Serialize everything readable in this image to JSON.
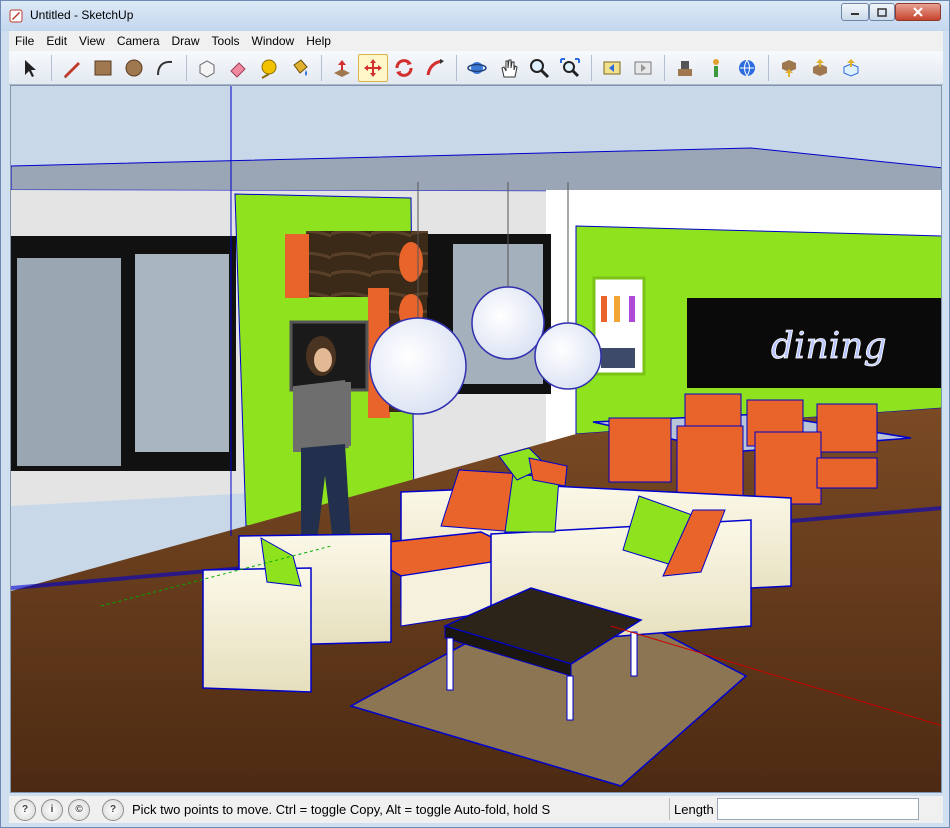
{
  "window": {
    "title": "Untitled - SketchUp"
  },
  "menu": [
    "File",
    "Edit",
    "View",
    "Camera",
    "Draw",
    "Tools",
    "Window",
    "Help"
  ],
  "toolbar": {
    "tools": [
      {
        "name": "select-tool-icon",
        "active": false
      },
      {
        "name": "pencil-line-tool-icon",
        "active": false
      },
      {
        "name": "rectangle-tool-icon",
        "active": false
      },
      {
        "name": "circle-tool-icon",
        "active": false
      },
      {
        "name": "arc-tool-icon",
        "active": false
      },
      {
        "name": "make-component-icon",
        "active": false
      },
      {
        "name": "eraser-tool-icon",
        "active": false
      },
      {
        "name": "tape-measure-tool-icon",
        "active": false
      },
      {
        "name": "paint-bucket-tool-icon",
        "active": false
      },
      {
        "name": "push-pull-tool-icon",
        "active": false
      },
      {
        "name": "move-tool-icon",
        "active": true
      },
      {
        "name": "rotate-tool-icon",
        "active": false
      },
      {
        "name": "follow-me-tool-icon",
        "active": false
      },
      {
        "name": "orbit-tool-icon",
        "active": false
      },
      {
        "name": "pan-tool-icon",
        "active": false
      },
      {
        "name": "zoom-tool-icon",
        "active": false
      },
      {
        "name": "zoom-extents-icon",
        "active": false
      },
      {
        "name": "previous-view-icon",
        "active": false
      },
      {
        "name": "next-view-icon",
        "active": false
      },
      {
        "name": "position-camera-icon",
        "active": false
      },
      {
        "name": "walk-tool-icon",
        "active": false
      },
      {
        "name": "get-current-view-icon",
        "active": false
      },
      {
        "name": "get-models-icon",
        "active": false
      },
      {
        "name": "share-model-icon",
        "active": false
      },
      {
        "name": "share-component-icon",
        "active": false
      }
    ]
  },
  "scene": {
    "sign_text": "dining"
  },
  "status": {
    "message": "Pick two points to move.  Ctrl = toggle Copy, Alt = toggle Auto-fold, hold S",
    "length_label": "Length",
    "length_value": ""
  },
  "colors": {
    "accent_green": "#8fe21e",
    "accent_orange": "#e8642a",
    "floor": "#6b3f1d",
    "selection_blue": "#0000cc"
  }
}
